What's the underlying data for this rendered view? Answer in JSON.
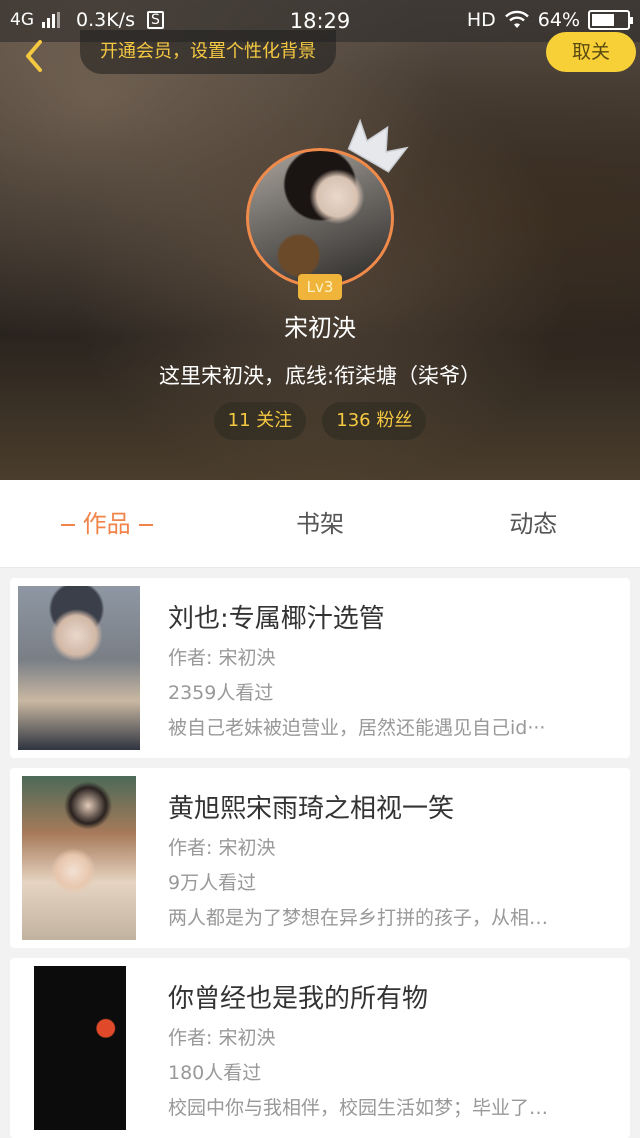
{
  "status_bar": {
    "network": "4G",
    "speed": "0.3K/s",
    "s_icon": "S",
    "time": "18:29",
    "hd": "HD",
    "battery": "64%",
    "battery_level": 0.64
  },
  "header": {
    "vip_banner": "开通会员，设置个性化背景",
    "unfollow_label": "取关",
    "back_icon": "chevron-left-icon"
  },
  "profile": {
    "level": "Lv3",
    "nickname": "宋初泱",
    "bio": "这里宋初泱，底线:衔柒塘（柒爷）",
    "following": "11 关注",
    "followers": "136 粉丝",
    "avatar_ring_color": "#f08a4b"
  },
  "tabs": [
    {
      "label": "作品",
      "active": true
    },
    {
      "label": "书架",
      "active": false
    },
    {
      "label": "动态",
      "active": false
    }
  ],
  "accent_color": "#f0844a",
  "books": [
    {
      "title": "刘也:专属椰汁选管",
      "author": "作者: 宋初泱",
      "views": "2359人看过",
      "desc": "被自己老妹被迫营业，居然还能遇见自己id···"
    },
    {
      "title": "黄旭熙宋雨琦之相视一笑",
      "author": "作者: 宋初泱",
      "views": "9万人看过",
      "desc": "两人都是为了梦想在异乡打拼的孩子，从相…"
    },
    {
      "title": "你曾经也是我的所有物",
      "author": "作者: 宋初泱",
      "views": "180人看过",
      "desc": "校园中你与我相伴，校园生活如梦；毕业了…"
    }
  ]
}
